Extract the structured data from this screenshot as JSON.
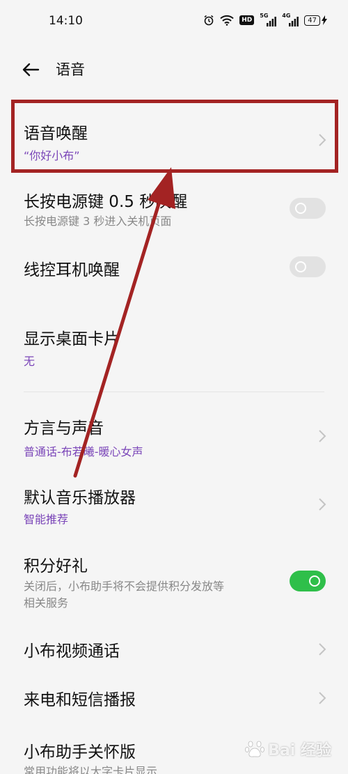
{
  "status_bar": {
    "time": "14:10",
    "hd_label": "HD",
    "net1": "5G",
    "net2": "4G",
    "battery": "47"
  },
  "header": {
    "title": "语音"
  },
  "items": {
    "voice_wakeup": {
      "title": "语音唤醒",
      "subtitle": "“你好小布”"
    },
    "power_key": {
      "title": "长按电源键 0.5 秒唤醒",
      "subtitle": "长按电源键 3 秒进入关机页面",
      "enabled": false
    },
    "wired_headset": {
      "title": "线控耳机唤醒",
      "enabled": false
    },
    "desktop_card": {
      "title": "显示桌面卡片",
      "subtitle": "无"
    },
    "dialect": {
      "title": "方言与声音",
      "subtitle": "普通话-布若曦-暖心女声"
    },
    "music_player": {
      "title": "默认音乐播放器",
      "subtitle": "智能推荐"
    },
    "points": {
      "title": "积分好礼",
      "subtitle_line1": "关闭后，小布助手将不会提供积分发放等",
      "subtitle_line2": "相关服务",
      "enabled": true
    },
    "video_call": {
      "title": "小布视频通话"
    },
    "call_sms": {
      "title": "来电和短信播报"
    },
    "care_version": {
      "title": "小布助手关怀版",
      "subtitle": "常用功能将以大字卡片显示"
    }
  },
  "watermark": {
    "text": "Bai 经验"
  },
  "colors": {
    "accent_purple": "#7a45b8",
    "toggle_on": "#2fbf4a",
    "annotation_red": "#a32323"
  }
}
